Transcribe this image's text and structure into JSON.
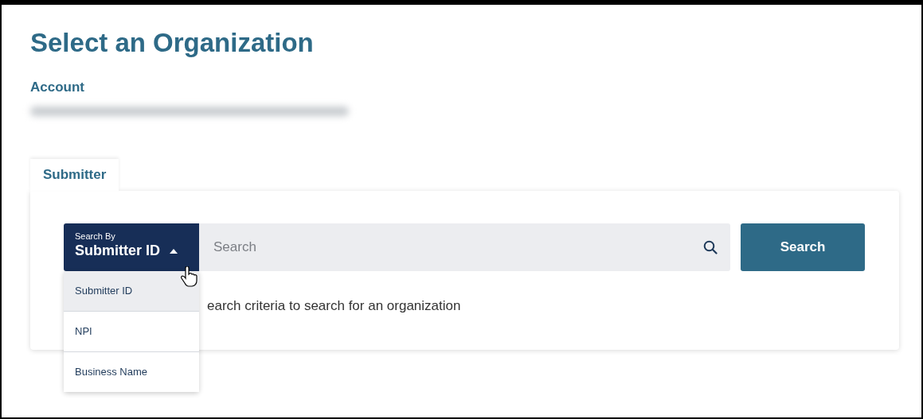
{
  "page": {
    "title": "Select an Organization"
  },
  "account": {
    "label": "Account",
    "value_blurred": true
  },
  "tabs": [
    {
      "label": "Submitter",
      "selected": true
    }
  ],
  "search": {
    "by_label": "Search By",
    "by_value": "Submitter ID",
    "expanded": true,
    "placeholder": "Search",
    "button": "Search",
    "hint": "earch criteria to search for an organization"
  },
  "dropdown_options": [
    {
      "label": "Submitter ID",
      "selected": true
    },
    {
      "label": "NPI",
      "selected": false
    },
    {
      "label": "Business Name",
      "selected": false
    }
  ]
}
